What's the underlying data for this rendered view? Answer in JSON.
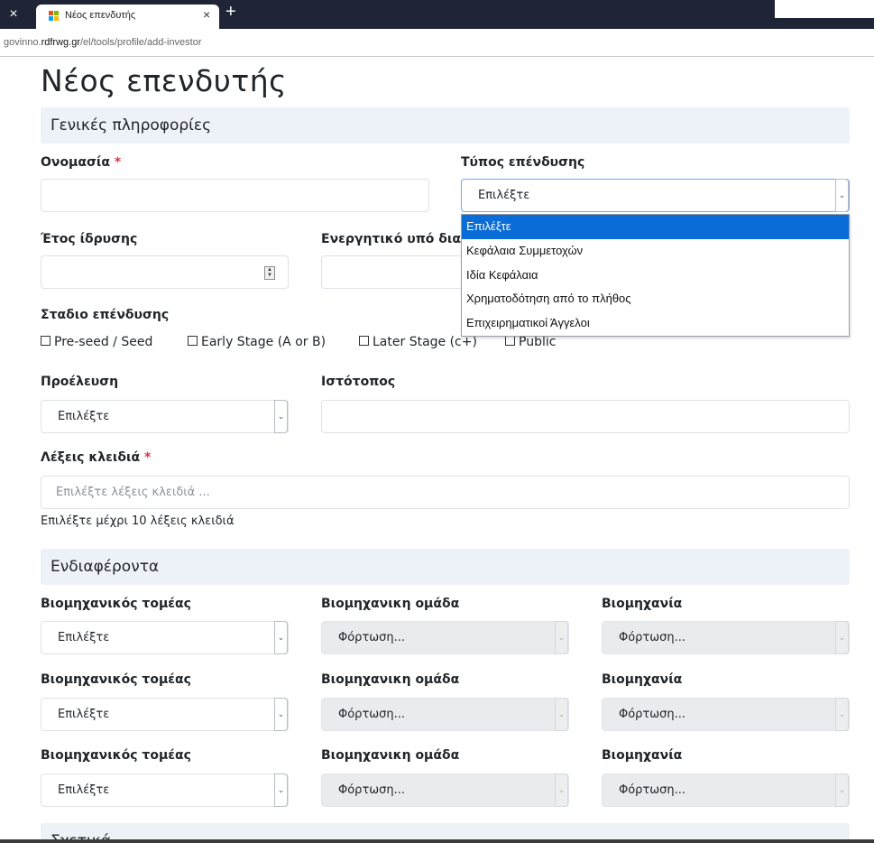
{
  "browser": {
    "tab_title": "Νέος επενδυτής",
    "url_prefix": "govinno.",
    "url_domain": "rdfrwg.gr",
    "url_path": "/el/tools/profile/add-investor",
    "close_glyph": "×",
    "new_tab_glyph": "+"
  },
  "page": {
    "title": "Νέος επενδυτής"
  },
  "general": {
    "section_title": "Γενικές πληροφορίες",
    "name_label": "Ονομασία",
    "required_mark": "*",
    "investment_type_label": "Τύπος επένδυσης",
    "investment_type_value": "Επιλέξτε",
    "founding_year_label": "Έτος ίδρυσης",
    "assets_label": "Ενεργητικό υπό διαχ",
    "stage_label": "Σταδιο επένδυσης",
    "stage_options": [
      "Pre-seed / Seed",
      "Early Stage (A or B)",
      "Later Stage (c+)",
      "Public"
    ],
    "origin_label": "Προέλευση",
    "origin_value": "Επιλέξτε",
    "website_label": "Ιστότοπος",
    "keywords_label": "Λέξεις κλειδιά",
    "keywords_placeholder": "Επιλέξτε λέξεις κλειδιά ...",
    "keywords_help": "Επιλέξτε μέχρι 10 λέξεις κλειδιά"
  },
  "investment_type_dropdown": {
    "options": [
      "Επιλέξτε",
      "Κεφάλαια Συμμετοχών",
      "Ιδία Κεφάλαια",
      "Χρηματοδότηση από το πλήθος",
      "Επιχειρηματικοί Άγγελοι"
    ],
    "highlighted_index": 0
  },
  "interests": {
    "section_title": "Ενδιαφέροντα",
    "rows": [
      {
        "sector_label": "Βιομηχανικός τομέας",
        "sector_value": "Επιλέξτε",
        "group_label": "Βιομηχανικη ομάδα",
        "group_value": "Φόρτωση...",
        "industry_label": "Βιομηχανία",
        "industry_value": "Φόρτωση..."
      },
      {
        "sector_label": "Βιομηχανικός τομέας",
        "sector_value": "Επιλέξτε",
        "group_label": "Βιομηχανικη ομάδα",
        "group_value": "Φόρτωση...",
        "industry_label": "Βιομηχανία",
        "industry_value": "Φόρτωση..."
      },
      {
        "sector_label": "Βιομηχανικός τομέας",
        "sector_value": "Επιλέξτε",
        "group_label": "Βιομηχανικη ομάδα",
        "group_value": "Φόρτωση...",
        "industry_label": "Βιομηχανία",
        "industry_value": "Φόρτωση..."
      }
    ]
  },
  "related": {
    "section_title": "Σχετικά"
  },
  "colors": {
    "section_bg": "#edf2f8",
    "required": "#dc3545",
    "dropdown_highlight": "#0a6cd6",
    "tabbar": "#202437"
  }
}
